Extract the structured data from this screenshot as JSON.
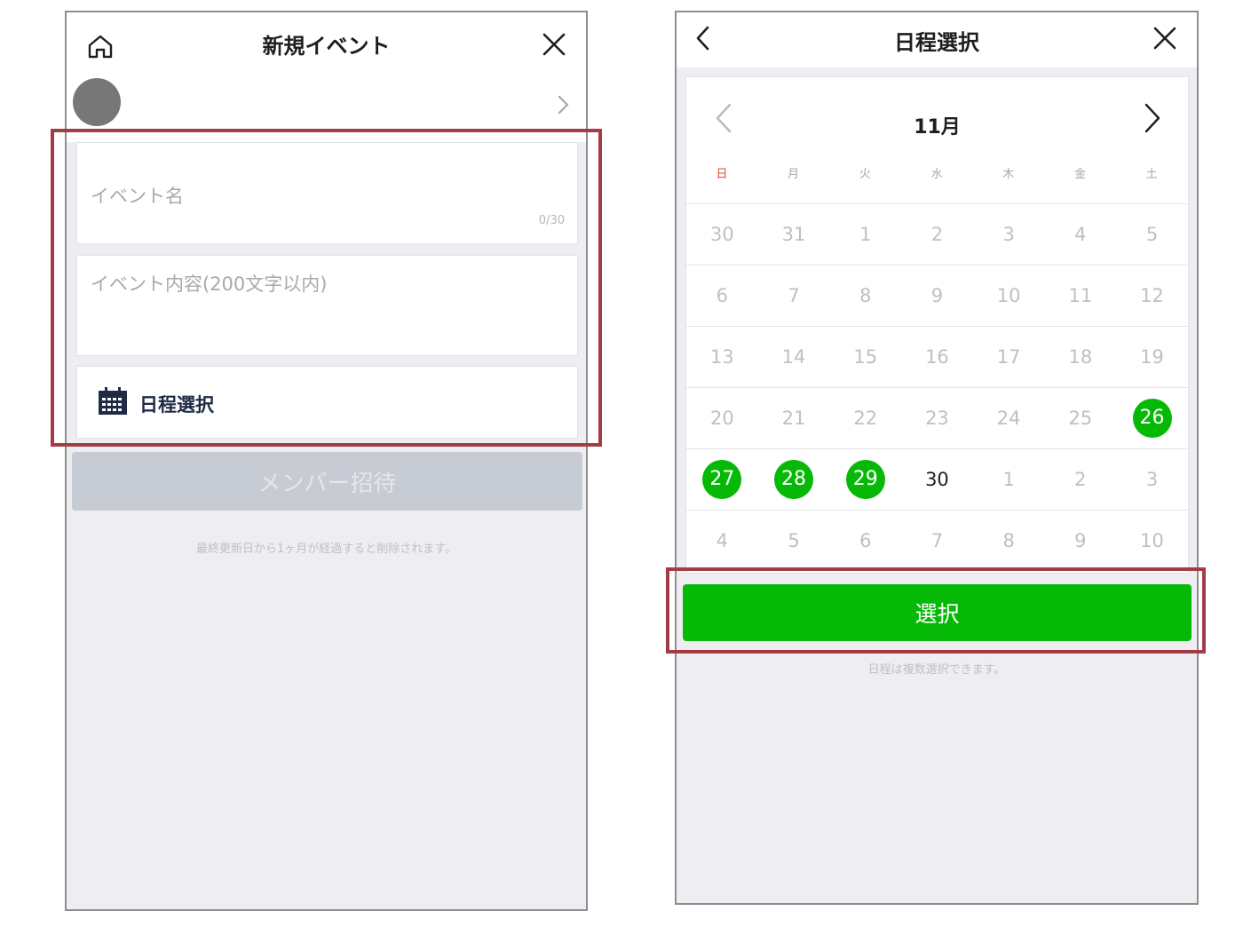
{
  "new_event": {
    "title": "新規イベント",
    "event_name_placeholder": "イベント名",
    "event_name_counter": "0/30",
    "event_detail_placeholder": "イベント内容(200文字以内)",
    "schedule_label": "日程選択",
    "invite_button": "メンバー招待",
    "footer_note": "最終更新日から1ヶ月が経過すると削除されます。"
  },
  "schedule": {
    "title": "日程選択",
    "month": "11月",
    "weekdays": [
      "日",
      "月",
      "火",
      "水",
      "木",
      "金",
      "土"
    ],
    "weeks": [
      [
        {
          "day": "30",
          "state": "muted"
        },
        {
          "day": "31",
          "state": "muted"
        },
        {
          "day": "1",
          "state": "muted"
        },
        {
          "day": "2",
          "state": "muted"
        },
        {
          "day": "3",
          "state": "muted"
        },
        {
          "day": "4",
          "state": "muted"
        },
        {
          "day": "5",
          "state": "muted"
        }
      ],
      [
        {
          "day": "6",
          "state": "muted"
        },
        {
          "day": "7",
          "state": "muted"
        },
        {
          "day": "8",
          "state": "muted"
        },
        {
          "day": "9",
          "state": "muted"
        },
        {
          "day": "10",
          "state": "muted"
        },
        {
          "day": "11",
          "state": "muted"
        },
        {
          "day": "12",
          "state": "muted"
        }
      ],
      [
        {
          "day": "13",
          "state": "muted"
        },
        {
          "day": "14",
          "state": "muted"
        },
        {
          "day": "15",
          "state": "muted"
        },
        {
          "day": "16",
          "state": "muted"
        },
        {
          "day": "17",
          "state": "muted"
        },
        {
          "day": "18",
          "state": "muted"
        },
        {
          "day": "19",
          "state": "muted"
        }
      ],
      [
        {
          "day": "20",
          "state": "muted"
        },
        {
          "day": "21",
          "state": "muted"
        },
        {
          "day": "22",
          "state": "muted"
        },
        {
          "day": "23",
          "state": "muted"
        },
        {
          "day": "24",
          "state": "muted"
        },
        {
          "day": "25",
          "state": "muted"
        },
        {
          "day": "26",
          "state": "selected"
        }
      ],
      [
        {
          "day": "27",
          "state": "selected"
        },
        {
          "day": "28",
          "state": "selected"
        },
        {
          "day": "29",
          "state": "selected"
        },
        {
          "day": "30",
          "state": "current"
        },
        {
          "day": "1",
          "state": "muted"
        },
        {
          "day": "2",
          "state": "muted"
        },
        {
          "day": "3",
          "state": "muted"
        }
      ],
      [
        {
          "day": "4",
          "state": "muted"
        },
        {
          "day": "5",
          "state": "muted"
        },
        {
          "day": "6",
          "state": "muted"
        },
        {
          "day": "7",
          "state": "muted"
        },
        {
          "day": "8",
          "state": "muted"
        },
        {
          "day": "9",
          "state": "muted"
        },
        {
          "day": "10",
          "state": "muted"
        }
      ]
    ],
    "select_button": "選択",
    "footer_note": "日程は複数選択できます。"
  },
  "colors": {
    "accent_green": "#06b906",
    "highlight_border": "#a33c46",
    "sunday_red": "#e5492c",
    "disabled_button": "#c7cbd3"
  },
  "icons": {
    "home": "home-icon",
    "close": "close-icon",
    "chevron_right": "chevron-right-icon",
    "chevron_left": "chevron-left-icon",
    "calendar": "calendar-icon"
  }
}
